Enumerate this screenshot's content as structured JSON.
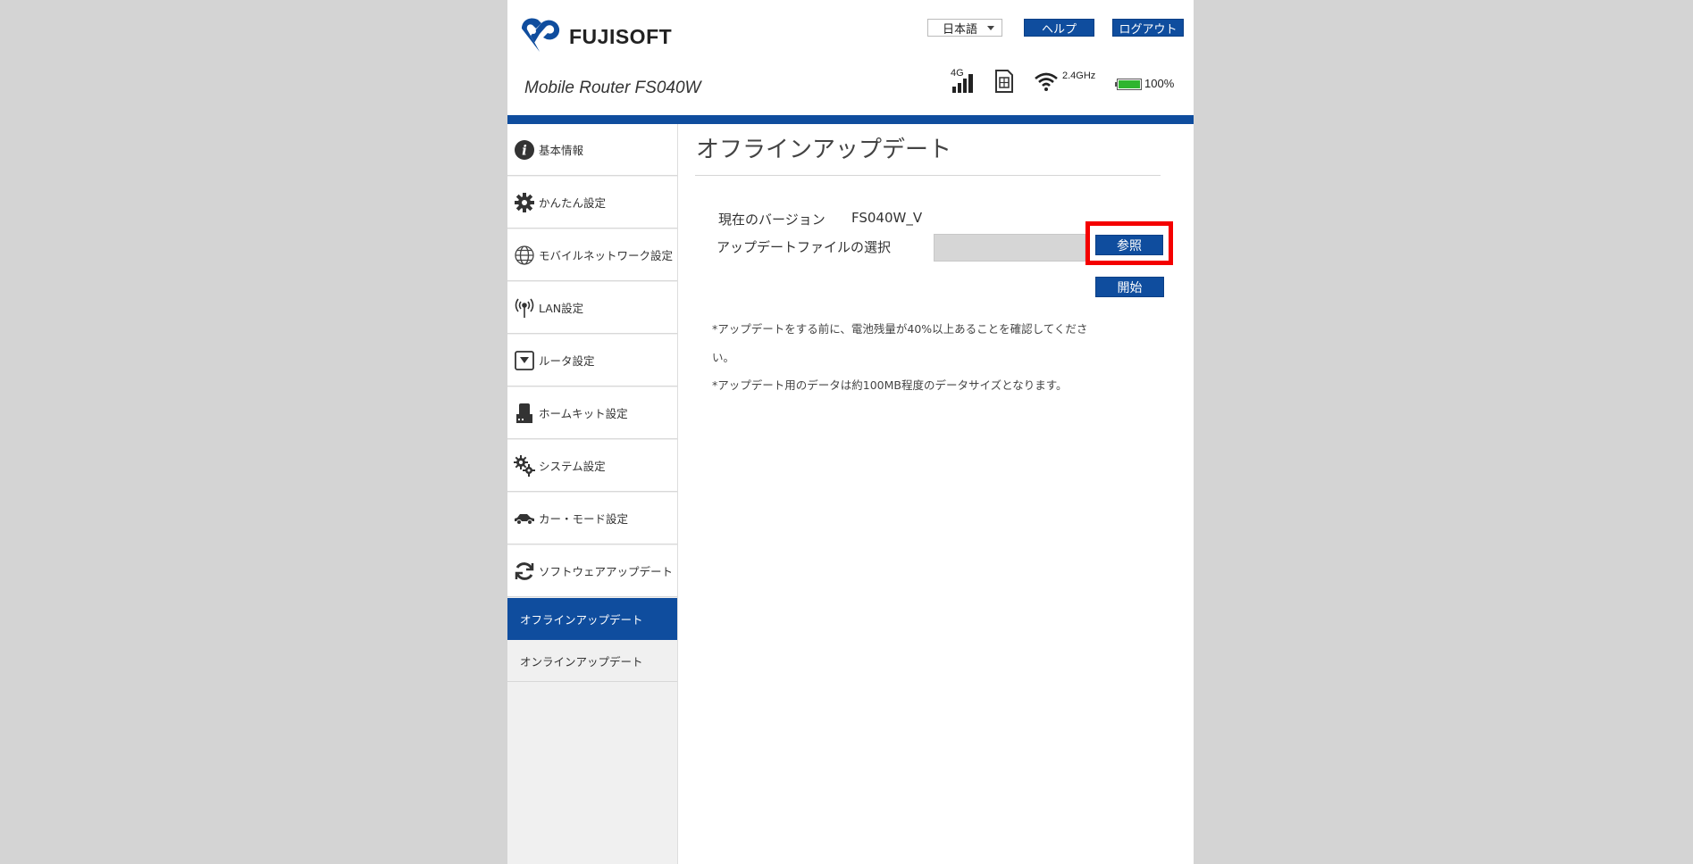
{
  "header": {
    "logo_text": "FUJISOFT",
    "model": "Mobile Router FS040W",
    "language": "日本語",
    "help_label": "ヘルプ",
    "logout_label": "ログアウト"
  },
  "status": {
    "network": "4G",
    "wifi_band": "2.4GHz",
    "battery": "100%",
    "battery_color": "#2fb52f",
    "brand_color": "#0f4d9e"
  },
  "sidebar": {
    "items": [
      {
        "label": "基本情報",
        "icon": "info-icon"
      },
      {
        "label": "かんたん設定",
        "icon": "gear-icon"
      },
      {
        "label": "モバイルネットワーク設定",
        "icon": "globe-icon"
      },
      {
        "label": "LAN設定",
        "icon": "antenna-icon"
      },
      {
        "label": "ルータ設定",
        "icon": "router-icon"
      },
      {
        "label": "ホームキット設定",
        "icon": "cradle-icon"
      },
      {
        "label": "システム設定",
        "icon": "gears-icon"
      },
      {
        "label": "カー・モード設定",
        "icon": "car-icon"
      },
      {
        "label": "ソフトウェアアップデート",
        "icon": "refresh-icon"
      }
    ],
    "sub_items": [
      {
        "label": "オフラインアップデート",
        "active": true
      },
      {
        "label": "オンラインアップデート",
        "active": false
      }
    ]
  },
  "main": {
    "title": "オフラインアップデート",
    "version_label": "現在のバージョン",
    "version_value": "FS040W_V",
    "file_label": "アップデートファイルの選択",
    "browse_label": "参照",
    "start_label": "開始",
    "note1_line1": "*アップデートをする前に、電池残量が40%以上あることを確認してくださ",
    "note1_line2": "い。",
    "note2": "*アップデート用のデータは約100MB程度のデータサイズとなります。"
  }
}
